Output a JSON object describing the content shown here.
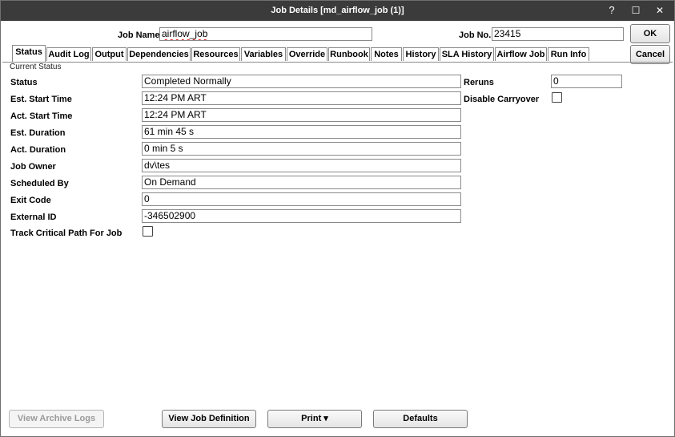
{
  "window": {
    "title": "Job Details [md_airflow_job (1)]",
    "help_label": "?",
    "maximize_label": "☐",
    "close_label": "✕"
  },
  "header": {
    "job_name_label": "Job Name",
    "job_name_value": "airflow_job",
    "job_no_label": "Job No.",
    "job_no_value": "23415"
  },
  "actions": {
    "ok_label": "OK",
    "cancel_label": "Cancel"
  },
  "tabs": [
    {
      "label": "Status",
      "active": true
    },
    {
      "label": "Audit Log"
    },
    {
      "label": "Output"
    },
    {
      "label": "Dependencies"
    },
    {
      "label": "Resources"
    },
    {
      "label": "Variables"
    },
    {
      "label": "Override"
    },
    {
      "label": "Runbook"
    },
    {
      "label": "Notes"
    },
    {
      "label": "History"
    },
    {
      "label": "SLA History"
    },
    {
      "label": "Airflow Job"
    },
    {
      "label": "Run Info"
    }
  ],
  "section_title": "Current Status",
  "fields": {
    "status": {
      "label": "Status",
      "value": "Completed Normally"
    },
    "est_start": {
      "label": "Est. Start Time",
      "value": "12:24 PM ART"
    },
    "act_start": {
      "label": "Act. Start Time",
      "value": "12:24 PM ART"
    },
    "est_duration": {
      "label": "Est. Duration",
      "value": "61 min  45 s"
    },
    "act_duration": {
      "label": "Act. Duration",
      "value": "0 min  5 s"
    },
    "job_owner": {
      "label": "Job Owner",
      "value": "dv\\tes"
    },
    "scheduled_by": {
      "label": "Scheduled By",
      "value": "On Demand"
    },
    "exit_code": {
      "label": "Exit Code",
      "value": "0"
    },
    "external_id": {
      "label": "External ID",
      "value": "-346502900"
    },
    "track_critical": {
      "label": "Track Critical Path For Job",
      "checked": false
    },
    "reruns": {
      "label": "Reruns",
      "value": "0"
    },
    "disable_carryover": {
      "label": "Disable Carryover",
      "checked": false
    }
  },
  "footer": {
    "view_archive_logs_label": "View Archive Logs",
    "view_job_definition_label": "View Job Definition",
    "print_label": "Print ▾",
    "defaults_label": "Defaults"
  }
}
